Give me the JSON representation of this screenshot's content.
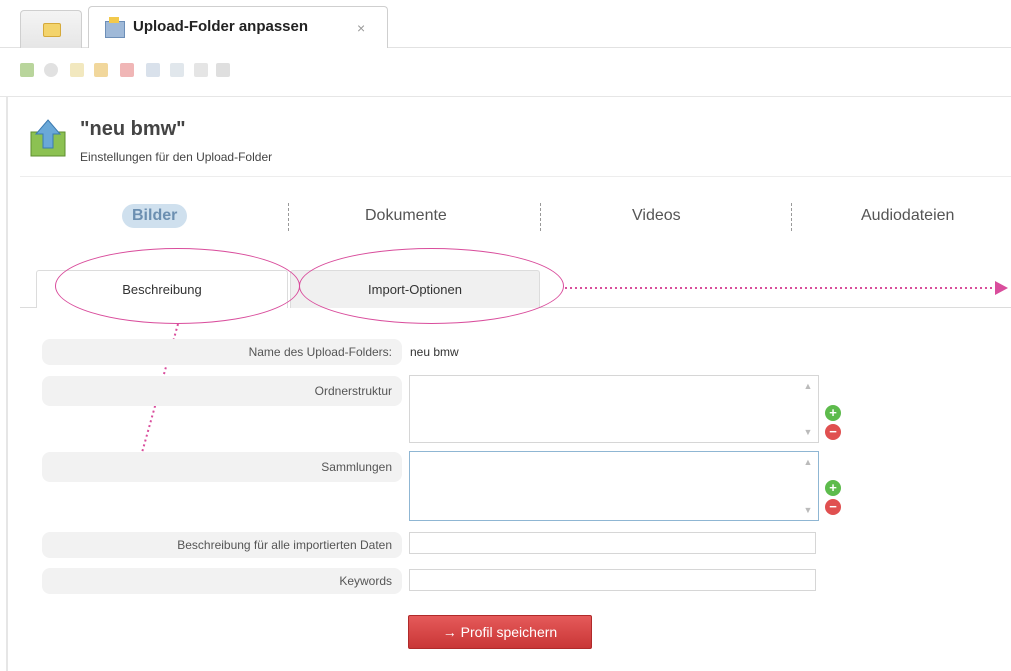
{
  "tabs": {
    "active_title": "Upload-Folder anpassen",
    "close_glyph": "×"
  },
  "toolbar": {
    "icons": [
      "arrow-down-icon",
      "circle-icon",
      "document-icon",
      "folder-icon",
      "delete-icon",
      "save-icon",
      "copy-icon",
      "page-icon",
      "stack-icon"
    ]
  },
  "header": {
    "title": "\"neu bmw\"",
    "subtitle": "Einstellungen für den Upload-Folder"
  },
  "media_tabs": [
    "Bilder",
    "Dokumente",
    "Videos",
    "Audiodateien"
  ],
  "sub_tabs": [
    "Beschreibung",
    "Import-Optionen"
  ],
  "form": {
    "name_label": "Name des Upload-Folders:",
    "name_value": "neu bmw",
    "ordnerstruktur_label": "Ordnerstruktur",
    "sammlungen_label": "Sammlungen",
    "beschreibung_label": "Beschreibung für alle importierten Daten",
    "keywords_label": "Keywords",
    "save_label": "→ Profil speichern"
  },
  "colors": {
    "accent": "#d94d9c",
    "save": "#d64545",
    "active_tab_bg": "#cfe0ee"
  }
}
